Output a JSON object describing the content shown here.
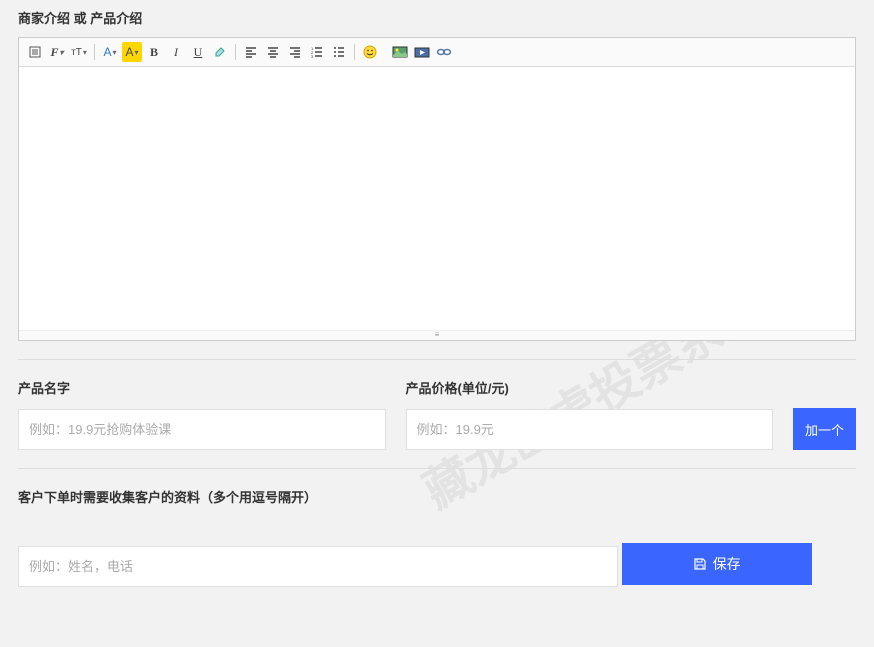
{
  "watermark": "藏龙卧虎投票系统",
  "editor": {
    "label": "商家介绍 或 产品介绍"
  },
  "product": {
    "name_label": "产品名字",
    "name_placeholder": "例如：19.9元抢购体验课",
    "price_label": "产品价格(单位/元)",
    "price_placeholder": "例如：19.9元",
    "add_button": "加一个"
  },
  "customer_info": {
    "label": "客户下单时需要收集客户的资料（多个用逗号隔开）",
    "placeholder": "例如：姓名，电话"
  },
  "save_button": "保存",
  "toolbar_labels": {
    "font_family": "F",
    "font_size": "ᴛT",
    "font_color": "A",
    "highlight": "A",
    "bold": "B",
    "italic": "I",
    "underline": "U"
  }
}
